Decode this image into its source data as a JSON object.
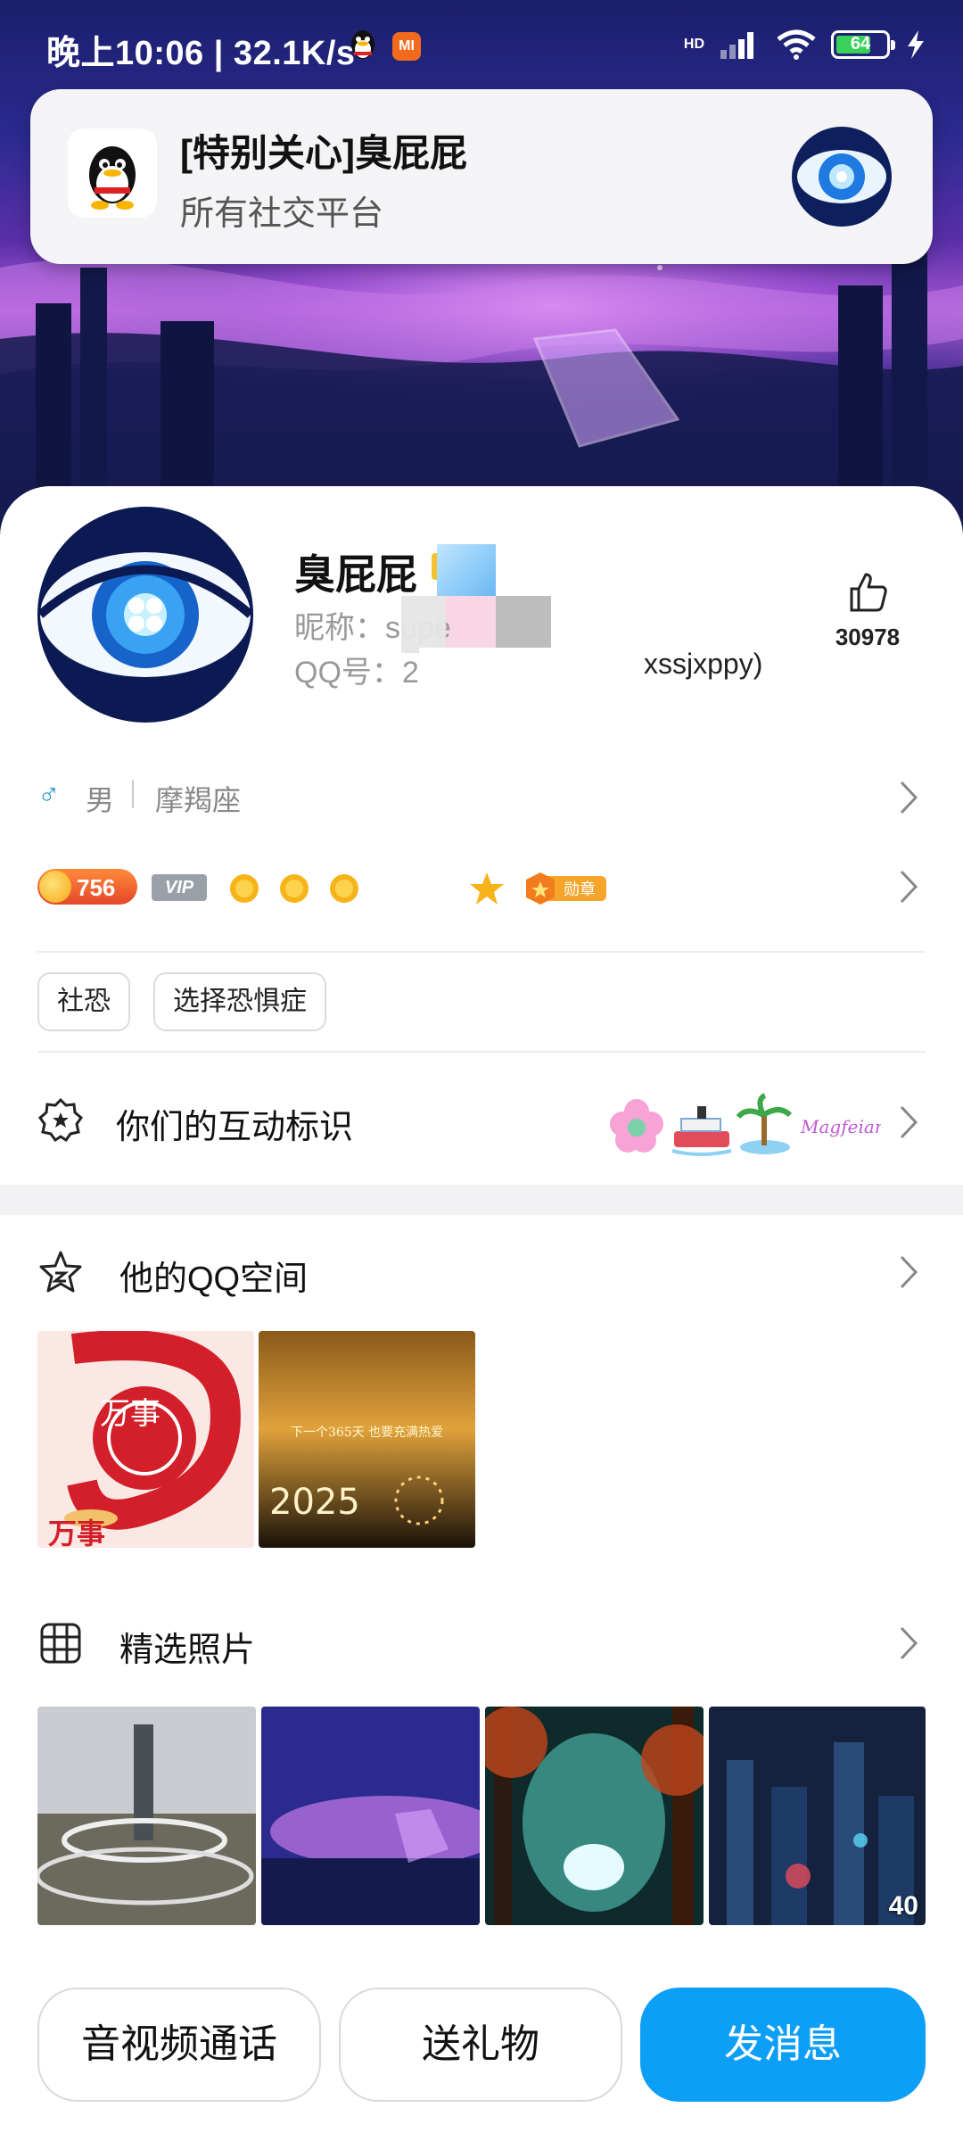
{
  "status_bar": {
    "time": "晚上10:06 | 32.1K/s",
    "mi_label": "MI",
    "battery": "64",
    "network_label": "HD"
  },
  "notification": {
    "title": "[特别关心]臭屁屁",
    "subtitle": "所有社交平台",
    "app_icon": "qq-penguin-icon"
  },
  "profile": {
    "name": "臭屁屁",
    "nickname": "昵称：supe",
    "qq": "QQ号：28",
    "qq_tail": "xssjxppy)",
    "likes": "30978"
  },
  "info": {
    "gender_icon": "♂",
    "gender": "男",
    "zodiac": "摩羯座",
    "coin_value": "756",
    "vip_label": "VIP",
    "medal_label": "勋章"
  },
  "tags": [
    "社恐",
    "选择恐惧症"
  ],
  "interaction": {
    "label": "你们的互动标识",
    "logo_text": "Magfeian"
  },
  "qzone": {
    "label": "他的QQ空间",
    "thumbs": [
      {
        "text_top": "万事",
        "text_big": "万事"
      },
      {
        "caption": "下一个365天 也要充满热爱",
        "year": "2025"
      }
    ]
  },
  "photos": {
    "label": "精选照片",
    "count": "40"
  },
  "buttons": {
    "call": "音视频通话",
    "gift": "送礼物",
    "message": "发消息"
  },
  "colors": {
    "accent": "#0d9ff5",
    "gender_blue": "#2e9bd6",
    "coin_orange": "#e4472a"
  }
}
